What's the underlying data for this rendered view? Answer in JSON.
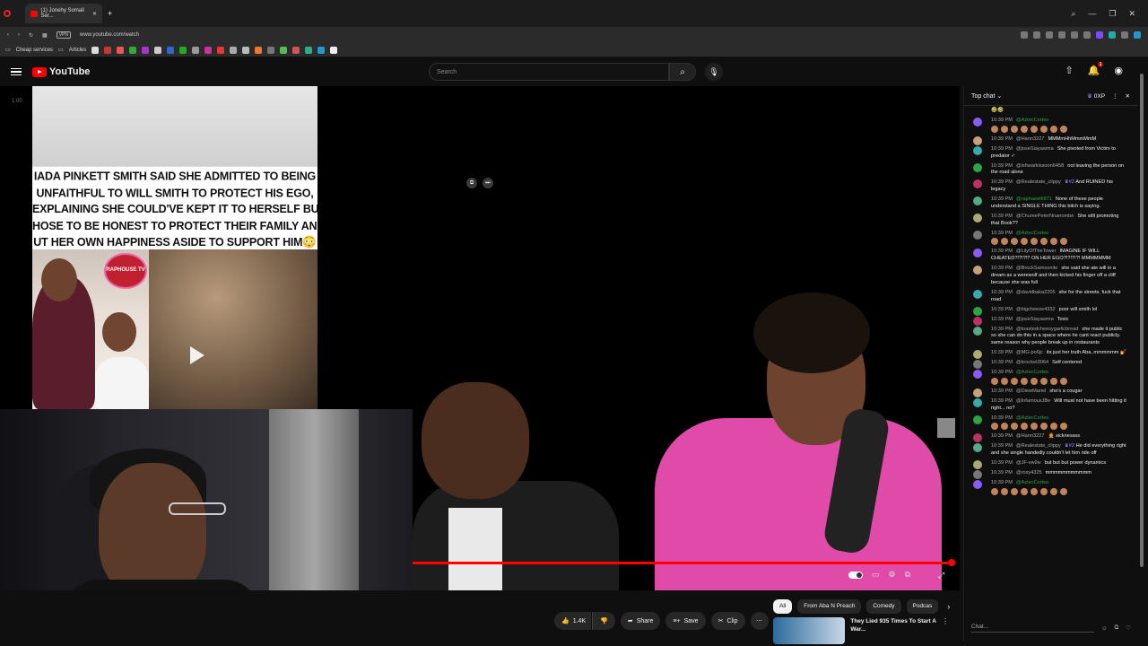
{
  "browser": {
    "tab_title": "(1) Jonehy Somali Ser...",
    "url": "www.youtube.com/watch",
    "vpn_label": "VPN",
    "bookmarks": [
      {
        "label": "Cheap services"
      },
      {
        "label": "Articles"
      }
    ]
  },
  "header": {
    "logo_text": "YouTube",
    "search_placeholder": "Search",
    "notification_count": "1"
  },
  "player": {
    "timestamp_small": "1.00",
    "thumbnail_caption": "IADA PINKETT SMITH SAID SHE ADMITTED TO BEING\nUNFAITHFUL TO WILL SMITH TO PROTECT HIS EGO,\nEXPLAINING SHE COULD'VE KEPT IT TO HERSELF BUT\nHOSE TO BE HONEST TO PROTECT THEIR FAMILY AND\nUT HER OWN HAPPINESS ASIDE TO SUPPORT HIM😳",
    "thumbnail_logo": "RAPHOUSE TV",
    "progress": 0.99
  },
  "actions": {
    "like_count": "1.4K",
    "share_label": "Share",
    "save_label": "Save",
    "clip_label": "Clip"
  },
  "chips": [
    "All",
    "From Aba N Preach",
    "Comedy",
    "Podcas"
  ],
  "recommendation": {
    "title": "They Lied 935 Times To Start A War..."
  },
  "chat": {
    "header_title": "Top chat",
    "xp_label": "0XP",
    "input_placeholder": "Chat...",
    "messages": [
      {
        "time": "",
        "author": "",
        "text": "🤣🤣",
        "member": false
      },
      {
        "time": "10:39 PM",
        "author": "@AztecCortes",
        "text": "",
        "member": true,
        "emotes": 8
      },
      {
        "time": "10:39 PM",
        "author": "@Hann3227",
        "text": "MMMmHhMmmMmM",
        "member": false
      },
      {
        "time": "10:39 PM",
        "author": "@joseSiayawma",
        "text": "She pivoted from Victim to predator ✓",
        "member": false
      },
      {
        "time": "10:39 PM",
        "author": "@ishwarkissoon6458",
        "text": "not leaving the person on the road alone",
        "member": false
      },
      {
        "time": "10:39 PM",
        "author": "@Realestate_clippy",
        "text": "And RUINED his legacy",
        "member": false,
        "badge": "#2"
      },
      {
        "time": "10:39 PM",
        "author": "@raphaeel6871",
        "text": "None of these people understand a SINGLE THING this bitch is saying.",
        "member": true
      },
      {
        "time": "10:39 PM",
        "author": "@ChumePeterNnanombe",
        "text": "She still promoting that Book??",
        "member": false
      },
      {
        "time": "10:39 PM",
        "author": "@AztecCortes",
        "text": "",
        "member": true,
        "emotes": 8
      },
      {
        "time": "10:39 PM",
        "author": "@LilyOfTheTower",
        "text": "IMAGINE IF WILL CHEATED?!?!?!? ON HER EGO?!?!?!?! MMMMMMM",
        "member": false
      },
      {
        "time": "10:39 PM",
        "author": "@BrockSamsonite",
        "text": "she said she ate will in a dream as a werewolf and then kicked his finger off a cliff because she was full",
        "member": false
      },
      {
        "time": "10:39 PM",
        "author": "@davidbaka2205",
        "text": "she for the streets, fuck that road",
        "member": false
      },
      {
        "time": "10:39 PM",
        "author": "@bigcheese4332",
        "text": "poor will smith lol",
        "member": false
      },
      {
        "time": "10:39 PM",
        "author": "@joseSiayawma",
        "text": "Toxic",
        "member": false
      },
      {
        "time": "10:39 PM",
        "author": "@toastedcheesygarlicbread",
        "text": "she made it public so she can do this in a space where he cant react publicly. same reason why people break up in restaurants",
        "member": false
      },
      {
        "time": "10:39 PM",
        "author": "@MG-po6jc",
        "text": "its just her truth Aba, mmmmmm 💅",
        "member": false
      },
      {
        "time": "10:39 PM",
        "author": "@krocket3064",
        "text": "Self centered",
        "member": false
      },
      {
        "time": "10:39 PM",
        "author": "@AztecCortes",
        "text": "",
        "member": true,
        "emotes": 8
      },
      {
        "time": "10:39 PM",
        "author": "@DiewMariel",
        "text": "she's a cougar",
        "member": false
      },
      {
        "time": "10:39 PM",
        "author": "@InfamousJBe",
        "text": "Will must not have been hitting it right... no?",
        "member": false
      },
      {
        "time": "10:39 PM",
        "author": "@AztecCortes",
        "text": "",
        "member": true,
        "emotes": 8
      },
      {
        "time": "10:39 PM",
        "author": "@Hann3227",
        "text": "🤦 sicknessss",
        "member": false
      },
      {
        "time": "10:39 PM",
        "author": "@Realestate_clippy",
        "text": "He did everything right and she single handedly couldn't let him ride off",
        "member": false,
        "badge": "#2"
      },
      {
        "time": "10:39 PM",
        "author": "@JF-vw9iv",
        "text": "but but but power dynamics",
        "member": false
      },
      {
        "time": "10:39 PM",
        "author": "@roxy4325",
        "text": "mmmmmmmmmmm",
        "member": false
      },
      {
        "time": "10:39 PM",
        "author": "@AztecCortes",
        "text": "",
        "member": true,
        "emotes": 8
      }
    ]
  },
  "colors": {
    "brand_red": "#ff0000",
    "member_green": "#2ba640",
    "background": "#0f0f0f"
  }
}
